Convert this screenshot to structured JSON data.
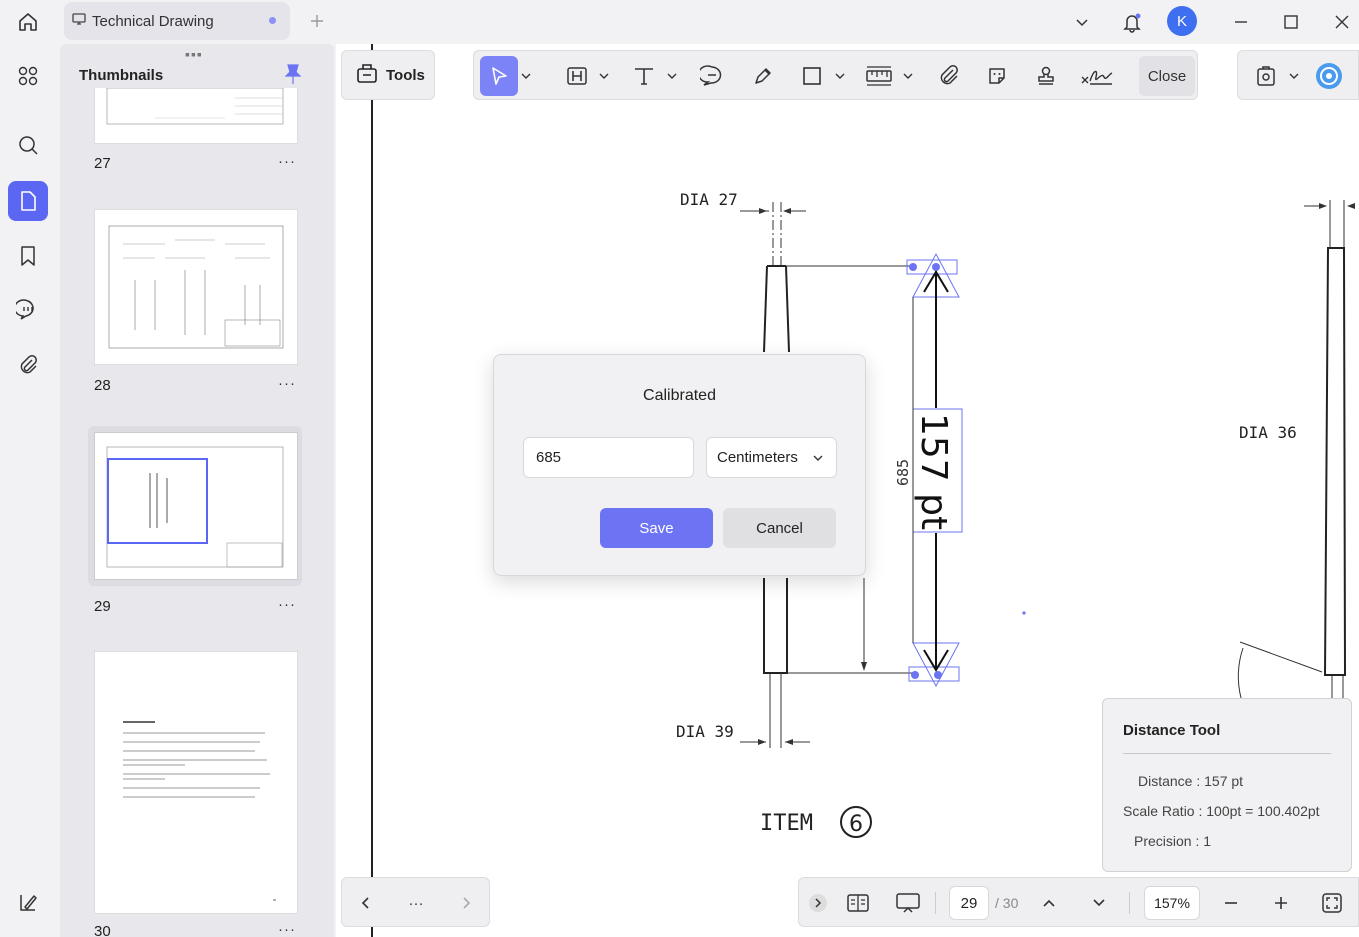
{
  "tab": {
    "title": "Technical Drawing"
  },
  "user": {
    "initial": "K"
  },
  "panel": {
    "title": "Thumbnails",
    "pages": [
      {
        "num": "27",
        "more": "···"
      },
      {
        "num": "28",
        "more": "···"
      },
      {
        "num": "29",
        "more": "···"
      },
      {
        "num": "30",
        "more": "···"
      }
    ]
  },
  "toolbar": {
    "tools_label": "Tools",
    "close_label": "Close"
  },
  "drawing": {
    "dia_27": "DIA 27",
    "dia_36": "DIA 36",
    "dia_39": "DIA 39",
    "item": "ITEM",
    "item_num": "6",
    "dim_685": "685",
    "measurement": "157 pt"
  },
  "dialog": {
    "title": "Calibrated",
    "value": "685",
    "unit": "Centimeters",
    "save": "Save",
    "cancel": "Cancel"
  },
  "distance": {
    "title": "Distance Tool",
    "distance": "Distance : 157 pt",
    "scale": "Scale Ratio : 100pt = 100.402pt",
    "precision": "Precision : 1"
  },
  "nav": {
    "page": "29",
    "total": "/ 30",
    "zoom": "157%",
    "more": "···"
  },
  "colors": {
    "accent": "#5b66f2",
    "primary_button": "#6c74f3",
    "avatar": "#3e6ff0"
  }
}
